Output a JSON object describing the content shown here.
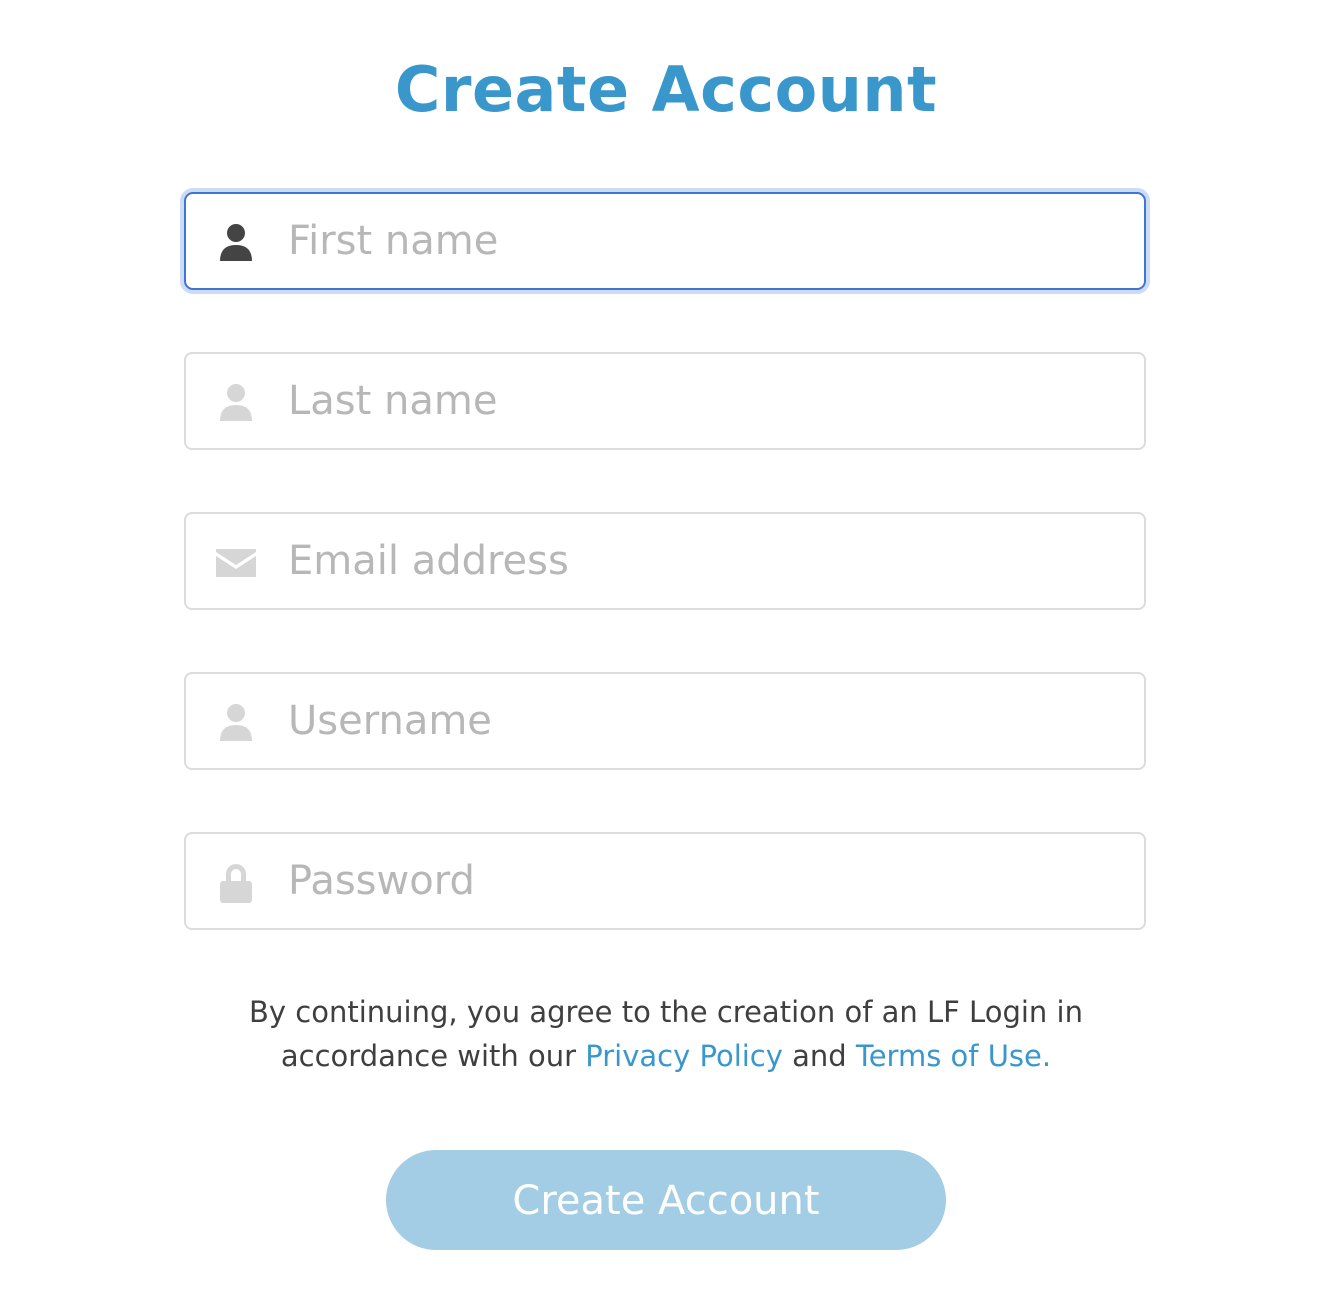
{
  "title": "Create Account",
  "fields": [
    {
      "name": "first-name",
      "placeholder": "First name",
      "icon": "user-icon",
      "value": "",
      "focused": true
    },
    {
      "name": "last-name",
      "placeholder": "Last name",
      "icon": "user-icon",
      "value": ""
    },
    {
      "name": "email",
      "placeholder": "Email address",
      "icon": "envelope-icon",
      "value": ""
    },
    {
      "name": "username",
      "placeholder": "Username",
      "icon": "user-icon",
      "value": ""
    },
    {
      "name": "password",
      "placeholder": "Password",
      "icon": "lock-icon",
      "value": ""
    }
  ],
  "legal": {
    "line1": "By continuing, you agree to the creation of an LF Login in",
    "line2_prefix": "accordance with our",
    "privacy_link": "Privacy Policy",
    "and": "and",
    "terms_link": "Terms of Use."
  },
  "submit_label": "Create Account",
  "colors": {
    "accent": "#3a97cc",
    "button_bg": "#a3cde4",
    "focus_border": "#3f76d6",
    "icon_active": "#444444",
    "icon_inactive": "#d6d6d6",
    "placeholder": "#b7b7b7"
  }
}
